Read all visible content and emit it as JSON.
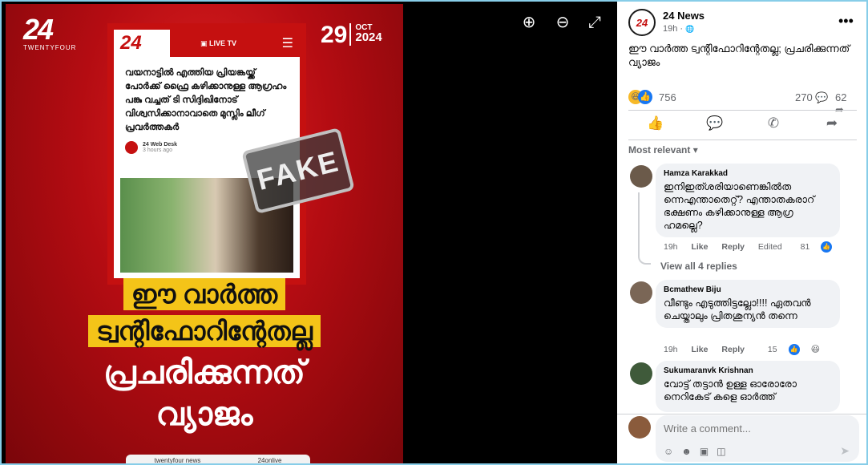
{
  "viewer": {
    "zoom_in_icon": "⊕",
    "zoom_out_icon": "⊖",
    "fullscreen_icon": "⤢",
    "poster": {
      "logo_number": "24",
      "logo_text": "TWENTYFOUR",
      "date_day": "29",
      "date_month": "OCT",
      "date_year": "2024",
      "card_logo": "24",
      "card_live": "LIVE TV",
      "card_menu_icon": "☰",
      "card_headline": "വയനാട്ടിൽ എത്തിയ പ്രിയങ്കയ്ക്ക് പോർക്ക് ഫ്രൈ കഴിക്കാനുള്ള ആഗ്രഹം പങ്കു വച്ചത് ടി സിദ്ദിഖിനോട് വിശ്വസിക്കാനാവാതെ മുസ്ലിം ലീഗ് പ്രവർത്തകർ",
      "card_author": "24 Web Desk",
      "card_time": "3 hours ago",
      "stamp": "FAKE",
      "slogan_line1": "ഈ വാർത്ത",
      "slogan_line2": "ട്വന്റിഫോറിന്റേതല്ല",
      "slogan_line3": "പ്രചരിക്കുന്നത്",
      "slogan_line4": "വ്യാജം",
      "footer_site": "twentyfour news",
      "footer_handle": "24onlive"
    }
  },
  "post": {
    "page_name": "24 News",
    "avatar_text": "24",
    "time": "19h",
    "audience_icon": "🌐",
    "more_icon": "•••",
    "caption": "ഈ വാർത്ത ട്വന്റിഫോറിന്റേതല്ല; പ്രചരിക്കുന്നത് വ്യാജം",
    "reactions_count": "756",
    "comments_count": "270",
    "shares_count": "62",
    "sort_label": "Most relevant",
    "like_icon": "👍",
    "comment_icon": "💬",
    "whatsapp_icon": "✆",
    "share_icon": "➦"
  },
  "comments": [
    {
      "name": "Hamza Karakkad",
      "text": "ഇനിഇത്ശരിയാണെങ്കിൽത ന്നെഎന്താതെറ്റ്? എന്താതകരാറ് ഭക്ഷണം കഴിക്കാനുള്ള ആഗ്ര ഹമല്ലെ?",
      "time": "19h",
      "like": "Like",
      "reply": "Reply",
      "edited": "Edited",
      "count": "81"
    },
    {
      "name": "Bcmathew Biju",
      "text": "വീണ്ടും എടുത്തിട്ടല്ലോ!!!! ഏതവൻ ചെയ്താലും പ്രിതശുന്യൻ തന്നെ",
      "time": "19h",
      "like": "Like",
      "reply": "Reply",
      "count": "15"
    },
    {
      "name": "Sukumaranvk Krishnan",
      "text": "വോട്ട് തട്ടാൻ ഉള്ള ഓരോരോ നെറികേട് കളെ ഓർത്ത്"
    }
  ],
  "view_replies": "View all 4 replies",
  "composer": {
    "placeholder": "Write a comment...",
    "send_icon": "➤"
  }
}
